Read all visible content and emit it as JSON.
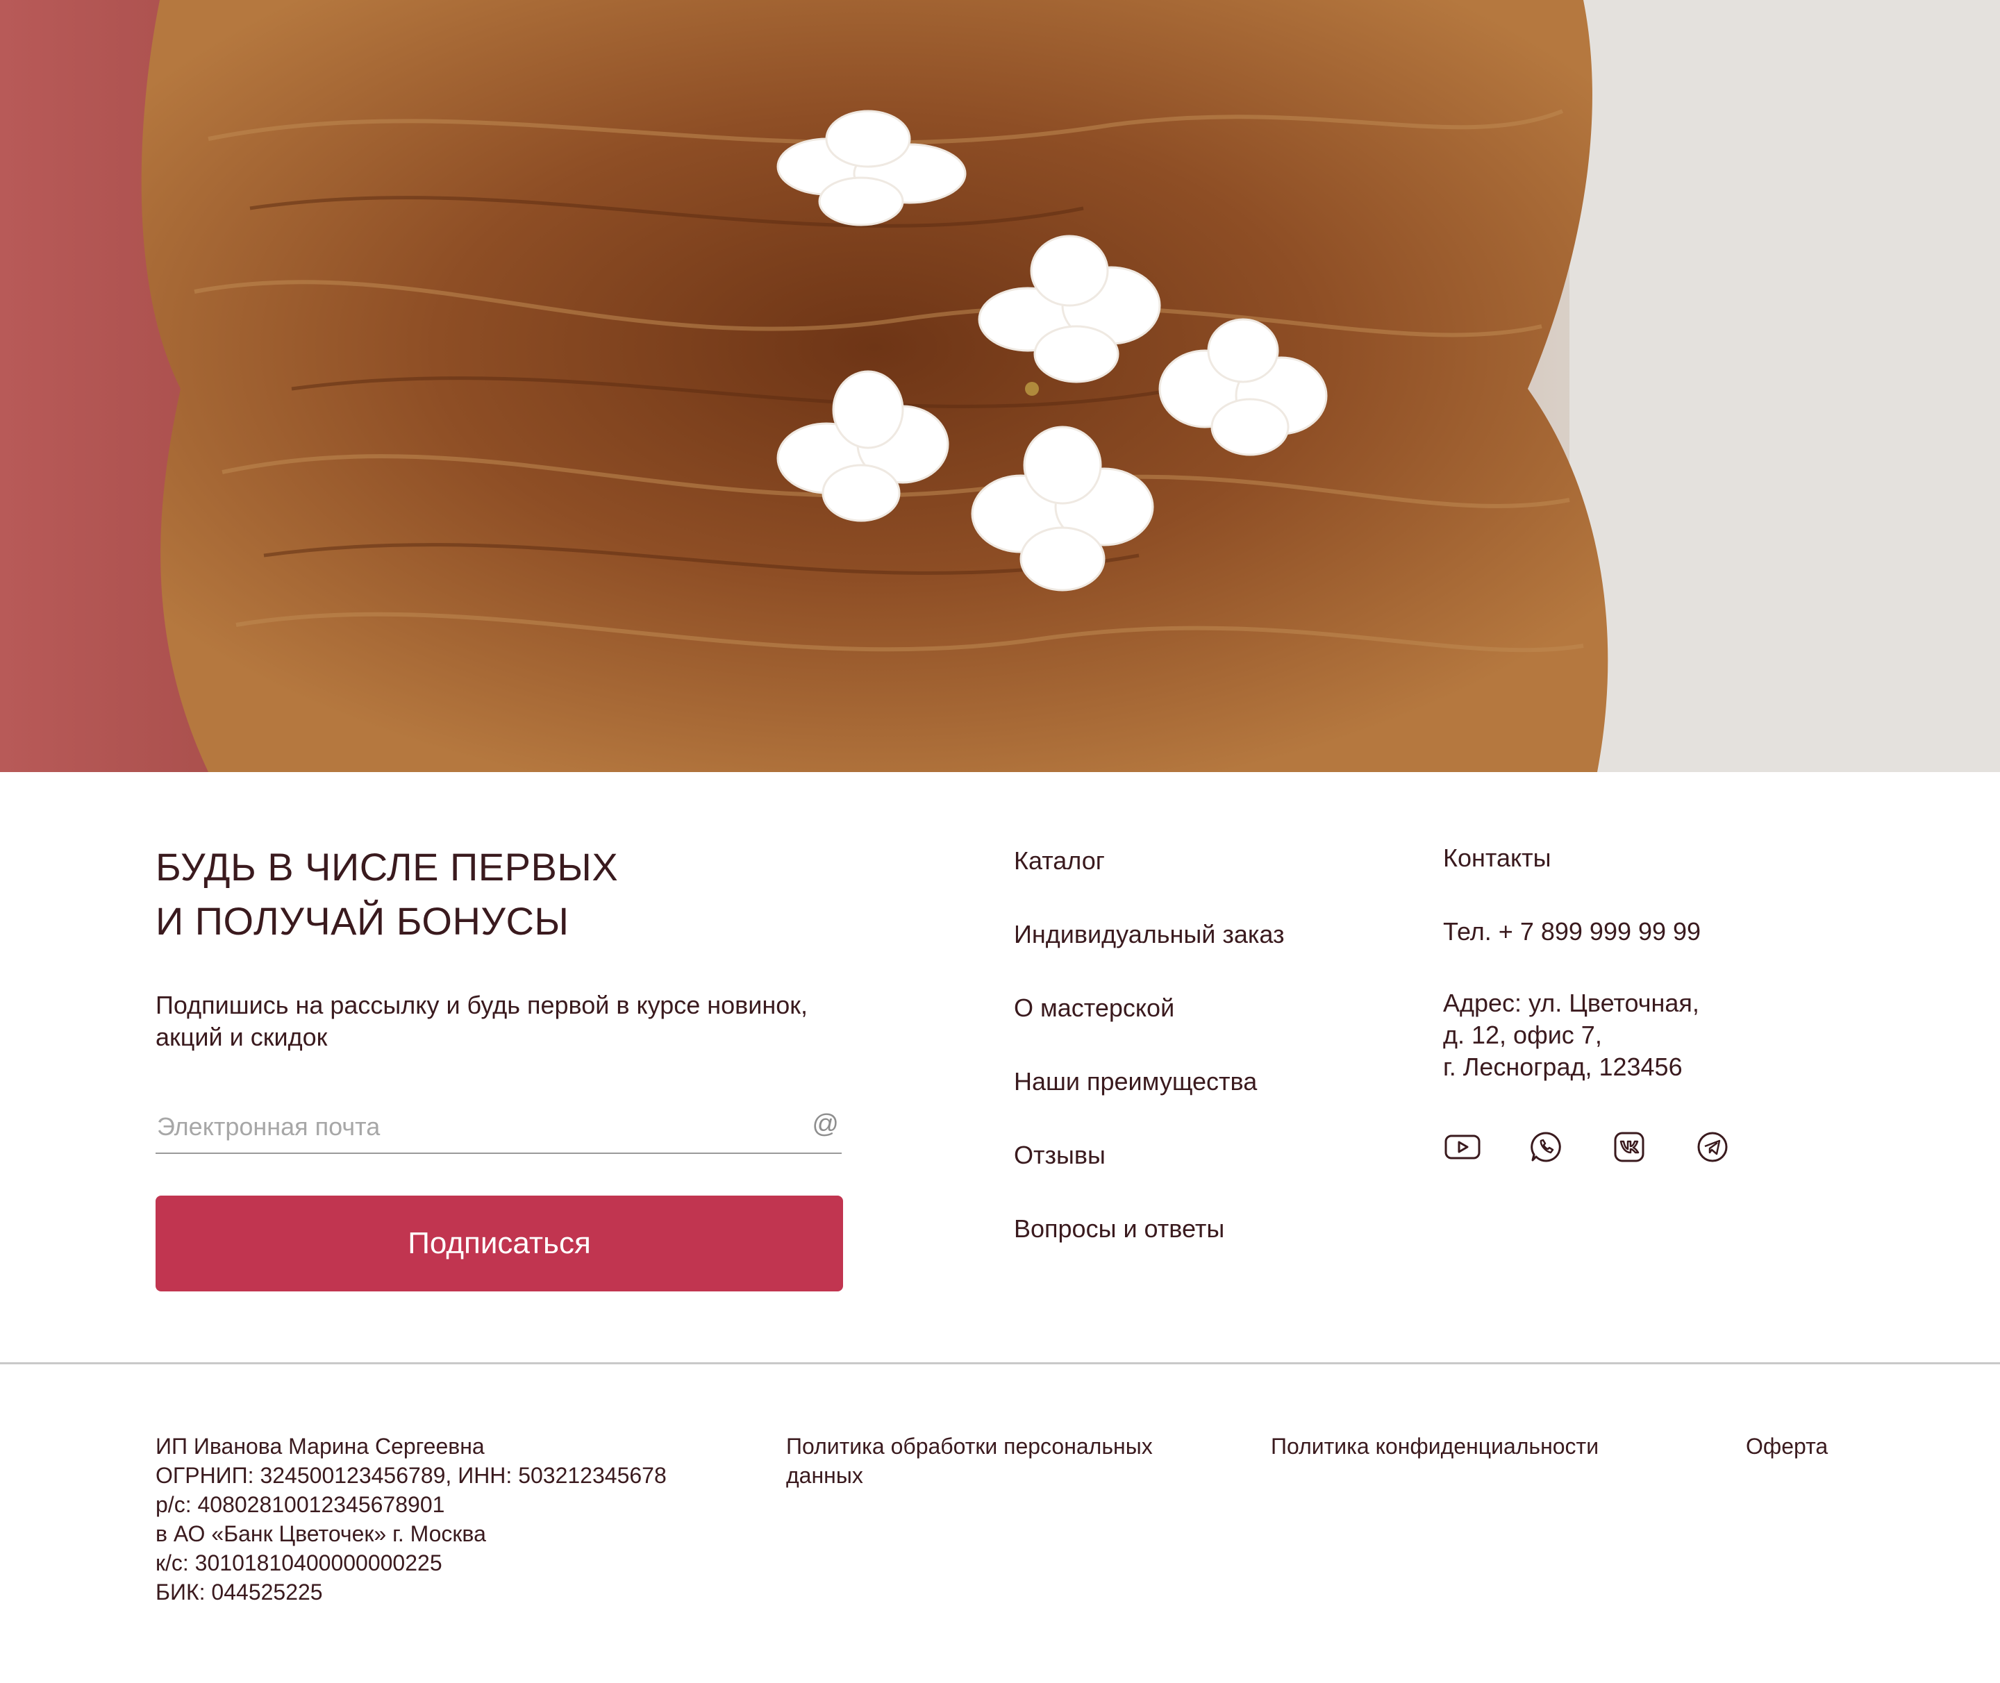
{
  "hero": {
    "image_alt": "Hair with white flower hairpins",
    "colors": {
      "hair": "#8a4a23",
      "backdrop_left": "#b85a58",
      "backdrop_right": "#e6e2de",
      "flowers": "#ffffff"
    }
  },
  "newsletter": {
    "title": "БУДЬ В ЧИСЛЕ ПЕРВЫХ\nИ ПОЛУЧАЙ БОНУСЫ",
    "text": "Подпишись на рассылку и будь первой в курсе новинок, акций и скидок",
    "email_placeholder": "Электронная почта",
    "at_symbol": "@",
    "button_label": "Подписаться",
    "button_color": "#c13550"
  },
  "nav": {
    "items": [
      {
        "label": "Каталог"
      },
      {
        "label": "Индивидуальный заказ"
      },
      {
        "label": "О мастерской"
      },
      {
        "label": "Наши преимущества"
      },
      {
        "label": "Отзывы"
      },
      {
        "label": "Вопросы и ответы"
      }
    ]
  },
  "contacts": {
    "title": "Контакты",
    "phone": "Тел. + 7 899 999 99 99",
    "address": "Адрес: ул. Цветочная,\nд. 12, офис 7,\nг. Лесноград, 123456",
    "socials": [
      {
        "icon": "youtube-icon"
      },
      {
        "icon": "whatsapp-icon"
      },
      {
        "icon": "vk-icon"
      },
      {
        "icon": "telegram-icon"
      }
    ]
  },
  "footer": {
    "legal_lines": [
      "ИП Иванова Марина Сергеевна",
      "ОГРНИП: 324500123456789, ИНН: 503212345678",
      "р/с: 40802810012345678901",
      "в АО «Банк Цветочек» г. Москва",
      "к/с: 30101810400000000225",
      "БИК: 044525225"
    ],
    "policy_personal": "Политика обработки персональных данных",
    "policy_privacy": "Политика конфиденциальности",
    "offer": "Оферта"
  }
}
